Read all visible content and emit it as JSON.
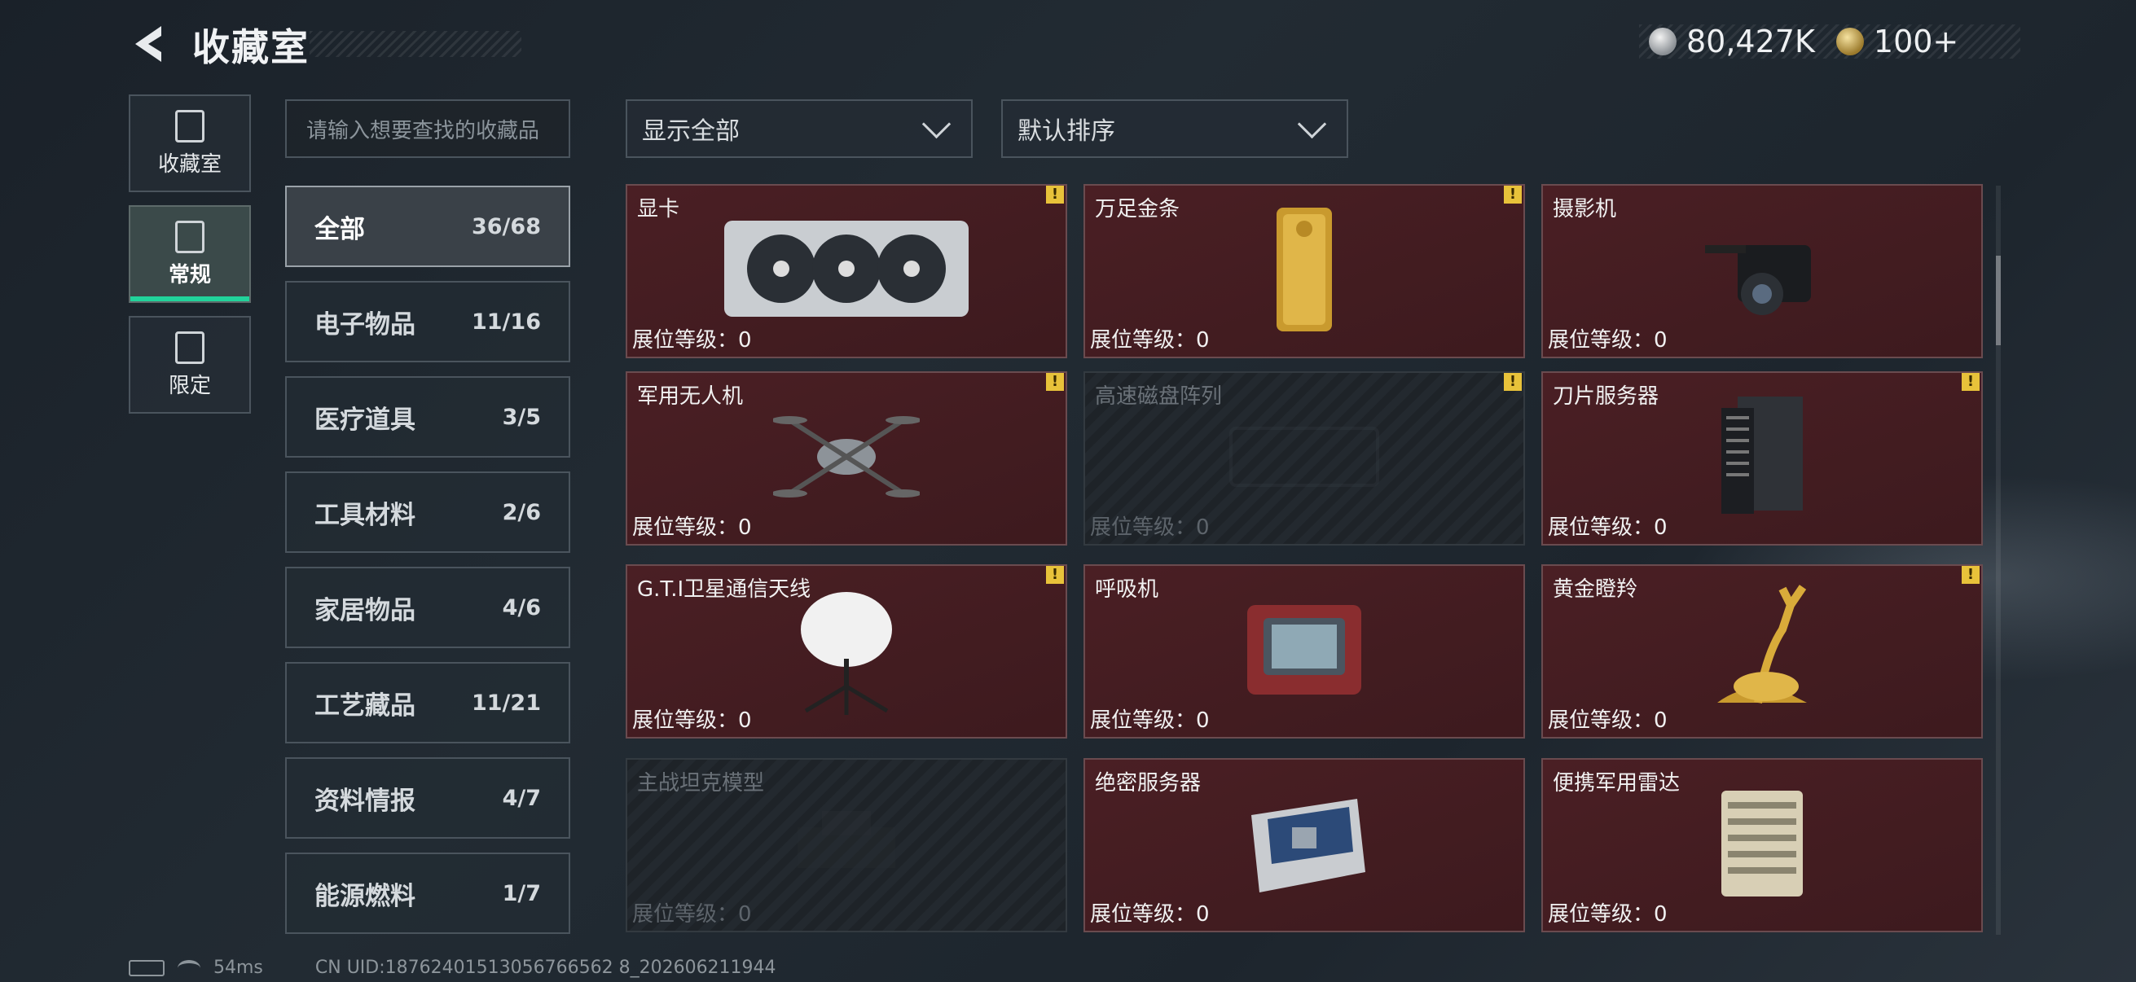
{
  "header": {
    "title": "收藏室"
  },
  "currency": [
    {
      "icon": "silver-coin-icon",
      "value": "80,427K"
    },
    {
      "icon": "gold-coin-icon",
      "value": "100+"
    }
  ],
  "nav": [
    {
      "label": "收藏室",
      "icon": "collection-room-icon",
      "active": false
    },
    {
      "label": "常规",
      "icon": "regular-icon",
      "active": true
    },
    {
      "label": "限定",
      "icon": "limited-icon",
      "active": false
    }
  ],
  "search": {
    "placeholder": "请输入想要查找的收藏品"
  },
  "filters": {
    "display": "显示全部",
    "sort": "默认排序"
  },
  "categories": [
    {
      "name": "全部",
      "count": "36/68",
      "active": true
    },
    {
      "name": "电子物品",
      "count": "11/16"
    },
    {
      "name": "医疗道具",
      "count": "3/5"
    },
    {
      "name": "工具材料",
      "count": "2/6"
    },
    {
      "name": "家居物品",
      "count": "4/6"
    },
    {
      "name": "工艺藏品",
      "count": "11/21"
    },
    {
      "name": "资料情报",
      "count": "4/7"
    },
    {
      "name": "能源燃料",
      "count": "1/7"
    }
  ],
  "items": [
    {
      "name": "显卡",
      "level": "展位等级：0",
      "locked": false,
      "alert": true
    },
    {
      "name": "万足金条",
      "level": "展位等级：0",
      "locked": false,
      "alert": true
    },
    {
      "name": "摄影机",
      "level": "展位等级：0",
      "locked": false,
      "alert": false
    },
    {
      "name": "军用无人机",
      "level": "展位等级：0",
      "locked": false,
      "alert": true
    },
    {
      "name": "高速磁盘阵列",
      "level": "展位等级：0",
      "locked": true,
      "alert": true
    },
    {
      "name": "刀片服务器",
      "level": "展位等级：0",
      "locked": false,
      "alert": true
    },
    {
      "name": "G.T.I卫星通信天线",
      "level": "展位等级：0",
      "locked": false,
      "alert": true
    },
    {
      "name": "呼吸机",
      "level": "展位等级：0",
      "locked": false,
      "alert": false
    },
    {
      "name": "黄金瞪羚",
      "level": "展位等级：0",
      "locked": false,
      "alert": true
    },
    {
      "name": "主战坦克模型",
      "level": "展位等级：0",
      "locked": true,
      "alert": false
    },
    {
      "name": "绝密服务器",
      "level": "展位等级：0",
      "locked": false,
      "alert": false
    },
    {
      "name": "便携军用雷达",
      "level": "展位等级：0",
      "locked": false,
      "alert": false
    }
  ],
  "alert_symbol": "!",
  "footer": {
    "ping": "54ms",
    "uid": "CN UID:18762401513056766562 8_202606211944"
  },
  "colors": {
    "accent": "#21d39b",
    "card_bg": "#4a1f24",
    "alert": "#e8c23a"
  }
}
